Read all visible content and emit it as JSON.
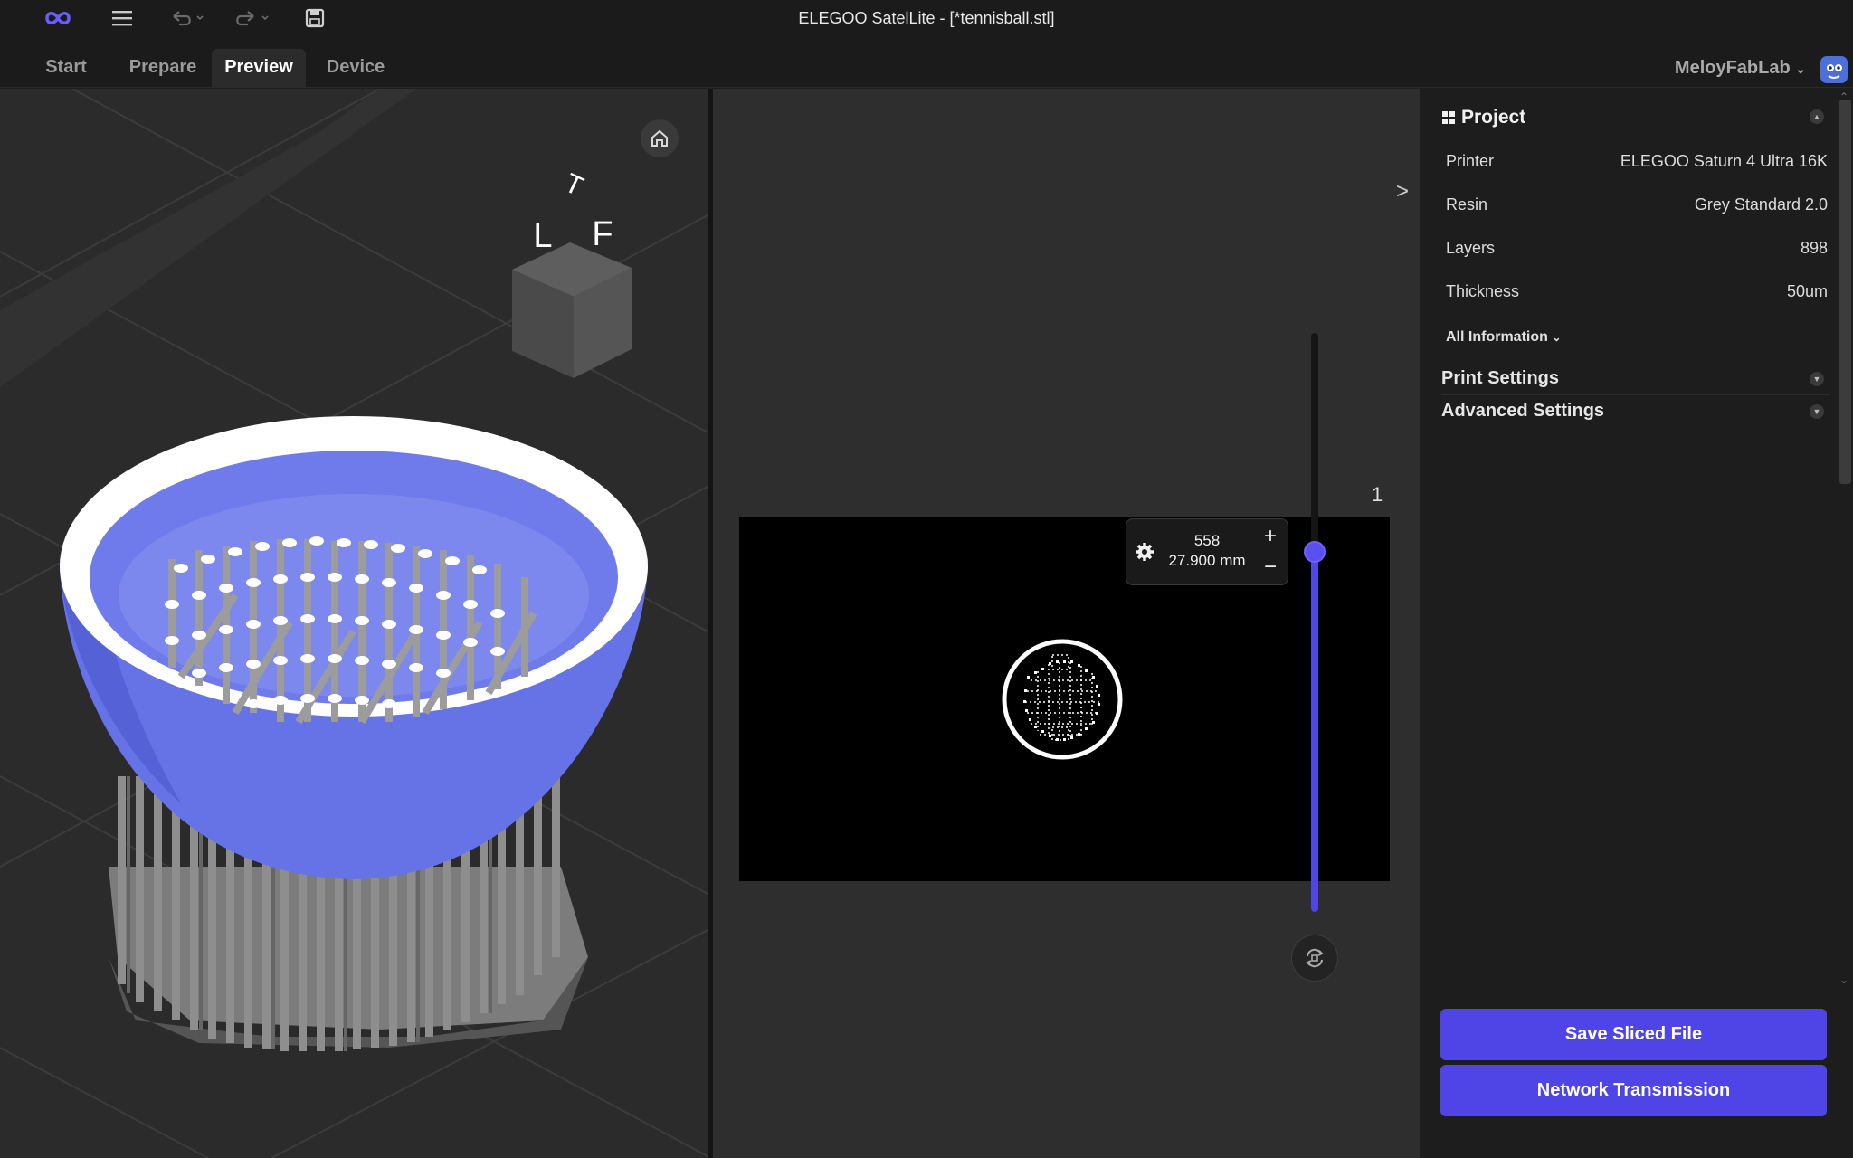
{
  "window": {
    "title": "ELEGOO SatelLite - [*tennisball.stl]"
  },
  "titlebar": {
    "logo_icon": "infinity-logo-icon",
    "menu_icon": "hamburger-menu-icon",
    "undo_icon": "undo-icon",
    "redo_icon": "redo-icon",
    "save_icon": "save-disk-icon"
  },
  "tabs": [
    {
      "label": "Start",
      "active": false
    },
    {
      "label": "Prepare",
      "active": false
    },
    {
      "label": "Preview",
      "active": true
    },
    {
      "label": "Device",
      "active": false
    }
  ],
  "user": {
    "name": "MeloyFabLab"
  },
  "viewport": {
    "cube": {
      "top": "T",
      "left": "L",
      "front": "F"
    },
    "home_icon": "home-icon"
  },
  "slice": {
    "layer_number": "558",
    "layer_height": "27.900 mm",
    "top_label": "1",
    "plus": "+",
    "minus": "−",
    "expand_label": ">",
    "gear_icon": "gear-icon",
    "sync_icon": "sync-view-icon"
  },
  "project": {
    "title": "Project",
    "rows": [
      {
        "label": "Printer",
        "value": "ELEGOO Saturn 4 Ultra 16K"
      },
      {
        "label": "Resin",
        "value": "Grey Standard 2.0"
      },
      {
        "label": "Layers",
        "value": "898"
      },
      {
        "label": "Thickness",
        "value": "50um"
      }
    ],
    "all_info": "All Information"
  },
  "sections": {
    "print_settings": "Print Settings",
    "advanced_settings": "Advanced Settings"
  },
  "buttons": {
    "save": "Save Sliced File",
    "network": "Network Transmission"
  },
  "colors": {
    "accent": "#4f44e6",
    "model_blue": "#6370e6",
    "support_grey": "#9a9a9a"
  }
}
